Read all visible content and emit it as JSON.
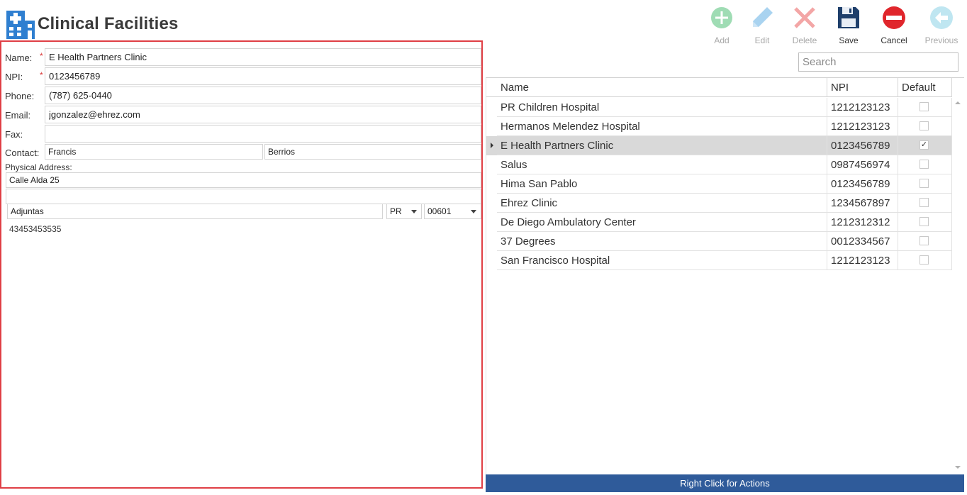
{
  "window": {
    "title": "Clinical Facilities",
    "icon": "hospital-building-icon"
  },
  "toolbar": {
    "add": {
      "label": "Add",
      "icon": "plus-circle-icon",
      "enabled": false,
      "color": "#7dcf9b"
    },
    "edit": {
      "label": "Edit",
      "icon": "pencil-icon",
      "enabled": false,
      "color": "#8cc4ea"
    },
    "delete": {
      "label": "Delete",
      "icon": "x-icon",
      "enabled": false,
      "color": "#f19a9a"
    },
    "save": {
      "label": "Save",
      "icon": "floppy-disk-icon",
      "enabled": true,
      "color": "#1f3f6b"
    },
    "cancel": {
      "label": "Cancel",
      "icon": "minus-circle-icon",
      "enabled": true,
      "color": "#e0262c"
    },
    "previous": {
      "label": "Previous",
      "icon": "arrow-left-circle-icon",
      "enabled": false,
      "color": "#a8dbe9"
    }
  },
  "search": {
    "placeholder": "Search",
    "value": ""
  },
  "form": {
    "name": {
      "label": "Name:",
      "value": "E Health Partners Clinic",
      "required": true
    },
    "npi": {
      "label": "NPI:",
      "value": "0123456789",
      "required": true
    },
    "phone": {
      "label": "Phone:",
      "value": "(787) 625-0440"
    },
    "email": {
      "label": "Email:",
      "value": "jgonzalez@ehrez.com"
    },
    "fax": {
      "label": "Fax:",
      "value": ""
    },
    "contact": {
      "label": "Contact:",
      "first": "Francis",
      "last": "Berrios"
    },
    "physical_address": {
      "label": "Physical Address:",
      "line1": "Calle Alda 25",
      "line2": "",
      "city": "Adjuntas",
      "state": "PR",
      "zip": "00601",
      "extra": "43453453535"
    },
    "required_marker": "*",
    "accent": "#e03f45"
  },
  "grid": {
    "columns": [
      "Name",
      "NPI",
      "Default"
    ],
    "rows": [
      {
        "name": "PR Children Hospital",
        "npi": "1212123123",
        "default": false,
        "selected": false
      },
      {
        "name": "Hermanos Melendez Hospital",
        "npi": "1212123123",
        "default": false,
        "selected": false
      },
      {
        "name": "E Health Partners Clinic",
        "npi": "0123456789",
        "default": true,
        "selected": true
      },
      {
        "name": "Salus",
        "npi": "0987456974",
        "default": false,
        "selected": false
      },
      {
        "name": "Hima San Pablo",
        "npi": "0123456789",
        "default": false,
        "selected": false
      },
      {
        "name": "Ehrez  Clinic",
        "npi": "1234567897",
        "default": false,
        "selected": false
      },
      {
        "name": "De Diego Ambulatory Center",
        "npi": "1212312312",
        "default": false,
        "selected": false
      },
      {
        "name": "37 Degrees",
        "npi": "0012334567",
        "default": false,
        "selected": false
      },
      {
        "name": "San Francisco Hospital",
        "npi": "1212123123",
        "default": false,
        "selected": false
      }
    ],
    "check_mark": "✓"
  },
  "status_bar": {
    "text": "Right Click for Actions",
    "color": "#2f5b9a"
  }
}
